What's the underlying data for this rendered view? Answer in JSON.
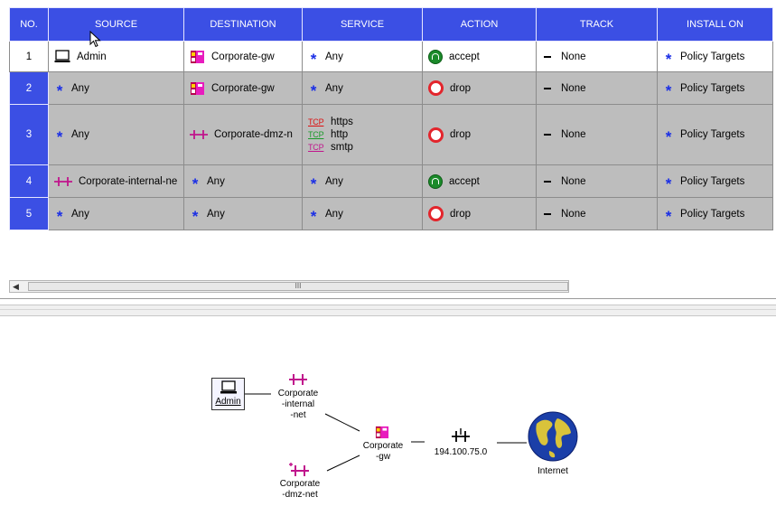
{
  "columns": {
    "no": "NO.",
    "source": "SOURCE",
    "destination": "DESTINATION",
    "service": "SERVICE",
    "action": "ACTION",
    "track": "TRACK",
    "install_on": "INSTALL ON"
  },
  "rules": [
    {
      "no": "1",
      "source": "Admin",
      "destination": "Corporate-gw",
      "service": [
        "Any"
      ],
      "action": "accept",
      "track": "None",
      "install_on": "Policy Targets"
    },
    {
      "no": "2",
      "source": "Any",
      "destination": "Corporate-gw",
      "service": [
        "Any"
      ],
      "action": "drop",
      "track": "None",
      "install_on": "Policy Targets"
    },
    {
      "no": "3",
      "source": "Any",
      "destination": "Corporate-dmz-n",
      "service": [
        "https",
        "http",
        "smtp"
      ],
      "action": "drop",
      "track": "None",
      "install_on": "Policy Targets"
    },
    {
      "no": "4",
      "source": "Corporate-internal-ne",
      "destination": "Any",
      "service": [
        "Any"
      ],
      "action": "accept",
      "track": "None",
      "install_on": "Policy Targets"
    },
    {
      "no": "5",
      "source": "Any",
      "destination": "Any",
      "service": [
        "Any"
      ],
      "action": "drop",
      "track": "None",
      "install_on": "Policy Targets"
    }
  ],
  "service_protocol_label": "TCP",
  "scrollbar": {
    "thumb_grip": "III"
  },
  "topology": {
    "admin": "Admin",
    "internal_net": [
      "Corporate",
      "-internal",
      "-net"
    ],
    "dmz_net": [
      "Corporate",
      "-dmz-net"
    ],
    "gateway": [
      "Corporate",
      "-gw"
    ],
    "ip": "194.100.75.0",
    "internet": "Internet"
  },
  "colors": {
    "header_blue": "#3b4fe4",
    "row_gray": "#bdbdbd",
    "accept_green": "#1b8a2a",
    "drop_red": "#e3252c",
    "network_magenta": "#c0148c"
  }
}
